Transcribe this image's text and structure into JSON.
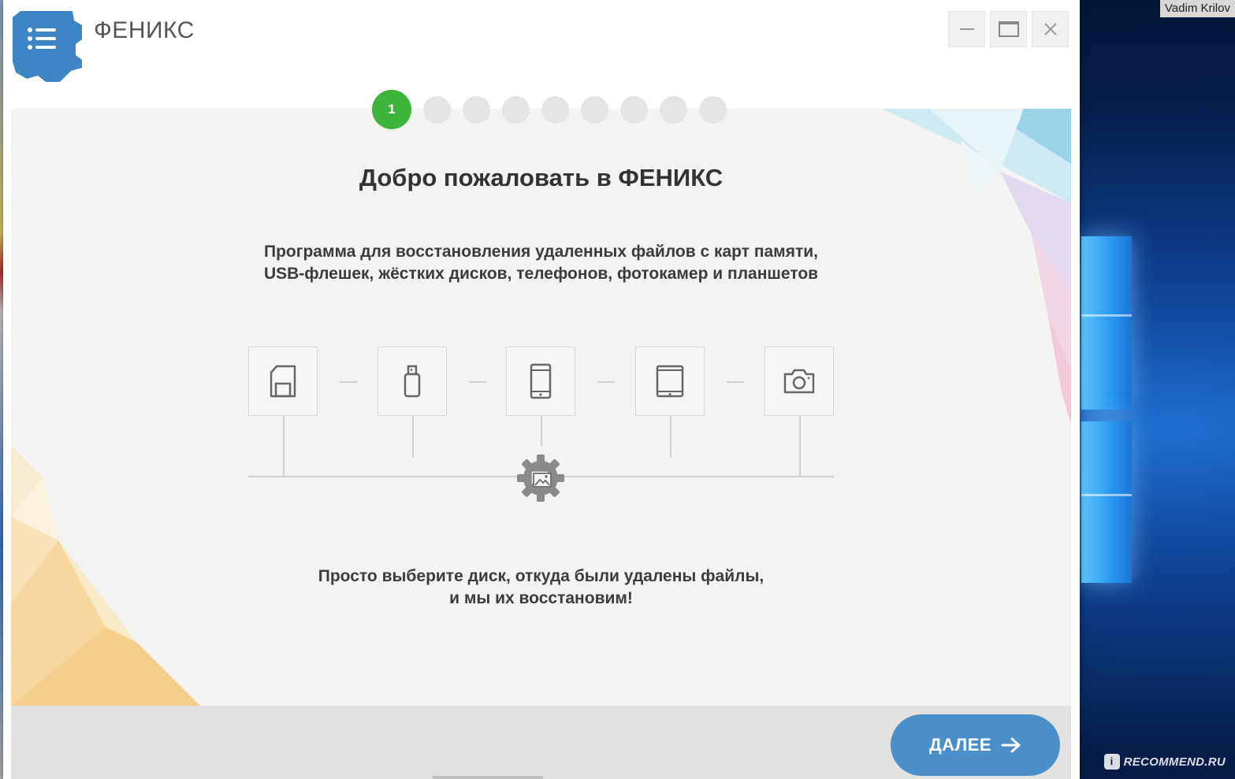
{
  "desktop": {
    "user_label": "Vadim Krilov",
    "watermark": "RECOMMEND.RU",
    "watermark_icon_glyph": "i"
  },
  "window": {
    "title": "ФЕНИКС",
    "controls": {
      "minimize_icon": "minimize-icon",
      "maximize_icon": "maximize-icon",
      "close_icon": "close-icon"
    }
  },
  "wizard": {
    "current_step": "1",
    "total_steps": 9
  },
  "content": {
    "title": "Добро пожаловать в ФЕНИКС",
    "description_lines": [
      "Программа для восстановления удаленных файлов с карт памяти,",
      "USB-флешек, жёстких дисков, телефонов, фотокамер и планшетов"
    ],
    "devices": [
      {
        "name": "memory-card",
        "icon": "memory-card-icon"
      },
      {
        "name": "usb-drive",
        "icon": "usb-drive-icon"
      },
      {
        "name": "phone",
        "icon": "phone-icon"
      },
      {
        "name": "tablet",
        "icon": "tablet-icon"
      },
      {
        "name": "camera",
        "icon": "camera-icon"
      }
    ],
    "outro_lines": [
      "Просто выберите диск, откуда были удалены файлы,",
      "и мы их восстановим!"
    ]
  },
  "footer": {
    "next_label": "ДАЛЕЕ"
  },
  "colors": {
    "accent_green": "#3db43a",
    "button_blue": "#4a8fca",
    "logo_blue": "#3d85c4"
  }
}
